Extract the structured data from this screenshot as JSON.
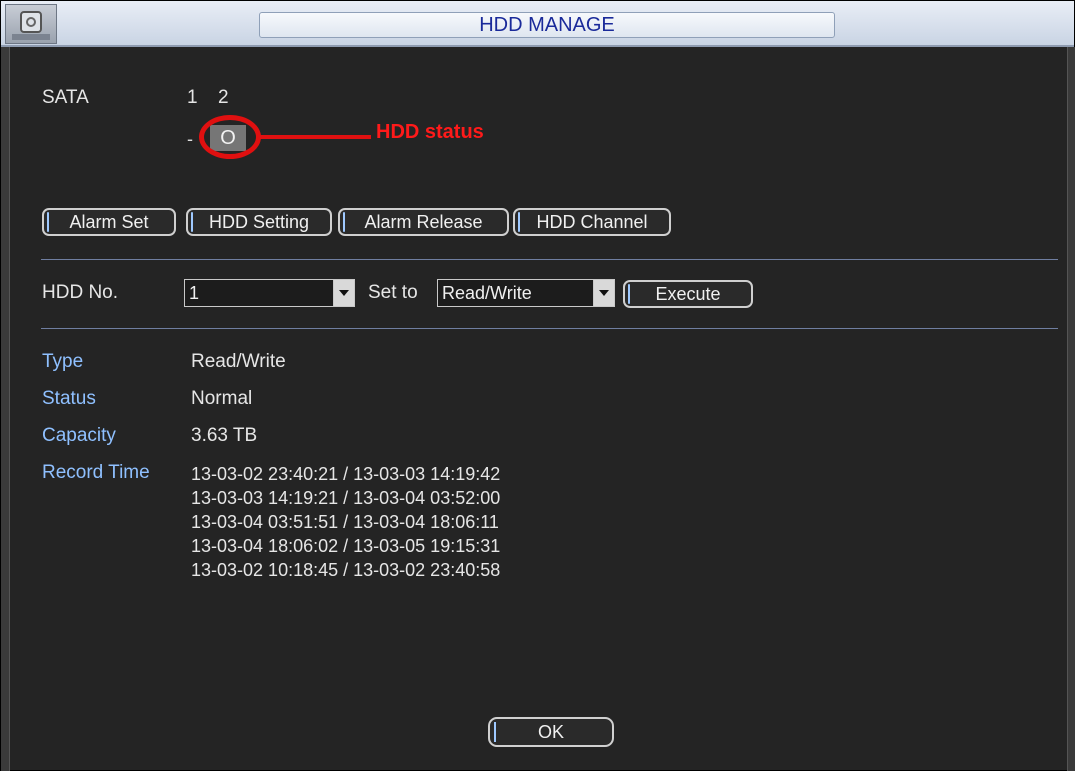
{
  "window": {
    "title": "HDD MANAGE"
  },
  "sata": {
    "label": "SATA",
    "ports": [
      "1",
      "2"
    ],
    "port1_status": "-",
    "port2_status": "O",
    "annotation": "HDD status"
  },
  "tabs": [
    "Alarm Set",
    "HDD Setting",
    "Alarm Release",
    "HDD Channel"
  ],
  "config": {
    "hdd_no_label": "HDD No.",
    "hdd_no_value": "1",
    "set_to_label": "Set to",
    "set_to_value": "Read/Write",
    "execute_label": "Execute"
  },
  "info": {
    "type_label": "Type",
    "type_value": "Read/Write",
    "status_label": "Status",
    "status_value": "Normal",
    "capacity_label": "Capacity",
    "capacity_value": "3.63 TB",
    "record_time_label": "Record Time",
    "record_times": [
      "13-03-02 23:40:21 / 13-03-03 14:19:42",
      "13-03-03 14:19:21 / 13-03-04 03:52:00",
      "13-03-04 03:51:51 / 13-03-04 18:06:11",
      "13-03-04 18:06:02 / 13-03-05 19:15:31",
      "13-03-02 10:18:45 / 13-03-02 23:40:58"
    ]
  },
  "footer": {
    "ok_label": "OK"
  },
  "colors": {
    "accent": "#1a2a9a",
    "annotation": "#e01010",
    "label_blue": "#8fc0ff",
    "background": "#242424"
  }
}
